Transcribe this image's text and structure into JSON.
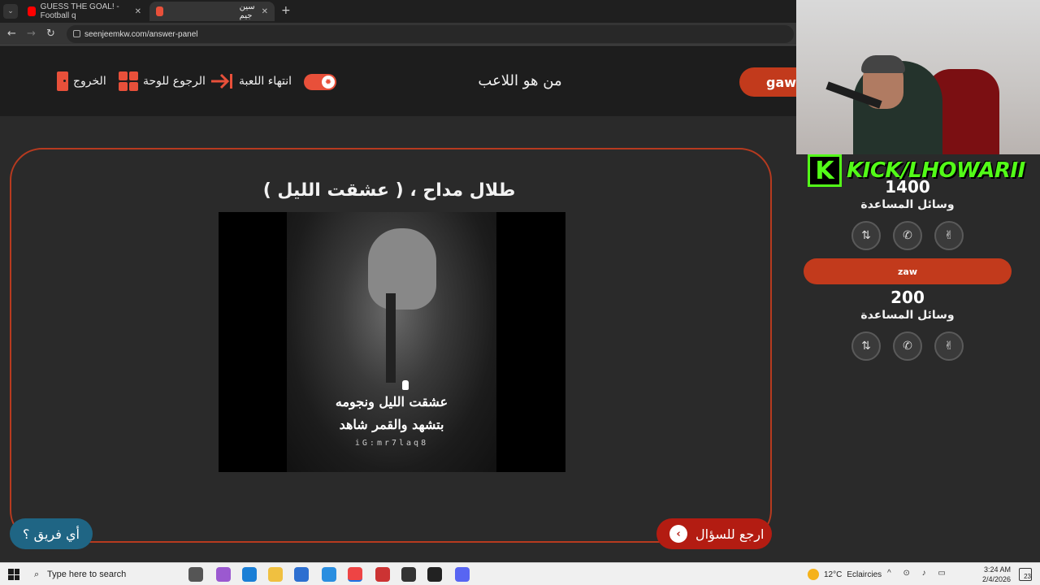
{
  "browser": {
    "tabs": [
      {
        "label": "GUESS THE GOAL! - Football q",
        "favicon_color": "#ff0000"
      },
      {
        "label": "سين جيم",
        "favicon_color": "#e8503a"
      }
    ],
    "new_tab_symbol": "+",
    "url": "seenjeemkw.com/answer-panel"
  },
  "header": {
    "exit_label": "الخروج",
    "back_to_board_label": "الرجوع للوحة",
    "end_game_label": "انتهاء اللعبة",
    "page_title": "من هو اللاعب",
    "team1_name": "gaw"
  },
  "question": {
    "title": "( عشقت الليل ) ، طلال مداح",
    "caption_line1": "عشقت الليل ونجومه",
    "caption_line2": "بتشهد والقمر شاهد",
    "caption_watermark": "iG:mr7laq8"
  },
  "buttons": {
    "back_to_question": "ارجع للسؤال",
    "which_team": "أي فريق ؟"
  },
  "stream": {
    "banner_text": "KICK/LHOWARII",
    "logo_letter": "K"
  },
  "teams": [
    {
      "name": "gaw",
      "score": "1400",
      "aids_label": "وسائل المساعدة"
    },
    {
      "name": "zaw",
      "score": "200",
      "aids_label": "وسائل المساعدة"
    }
  ],
  "taskbar": {
    "search_placeholder": "Type here to search",
    "weather_temp": "12°C",
    "weather_desc": "Eclaircies",
    "time": "3:24 AM",
    "date": "2/4/2026",
    "notification_count": "23"
  },
  "colors": {
    "accent": "#e8503a",
    "team_pill": "#c23a1c",
    "back_button": "#b31c12",
    "which_team_button": "#1f6584",
    "kick_green": "#53fc18"
  }
}
